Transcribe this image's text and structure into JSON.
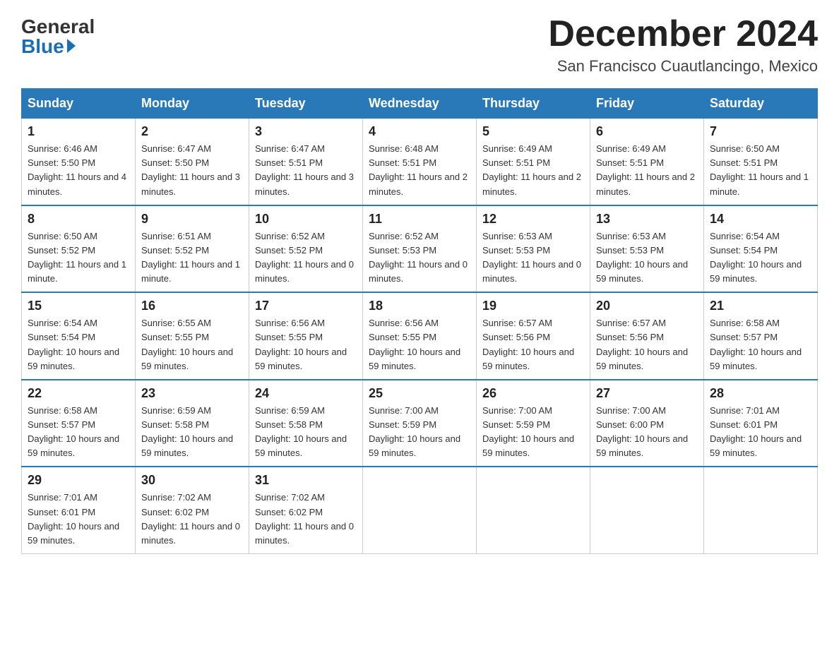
{
  "header": {
    "logo_general": "General",
    "logo_blue": "Blue",
    "month_year": "December 2024",
    "location": "San Francisco Cuautlancingo, Mexico"
  },
  "days_of_week": [
    "Sunday",
    "Monday",
    "Tuesday",
    "Wednesday",
    "Thursday",
    "Friday",
    "Saturday"
  ],
  "weeks": [
    [
      {
        "day": "1",
        "sunrise": "6:46 AM",
        "sunset": "5:50 PM",
        "daylight": "11 hours and 4 minutes."
      },
      {
        "day": "2",
        "sunrise": "6:47 AM",
        "sunset": "5:50 PM",
        "daylight": "11 hours and 3 minutes."
      },
      {
        "day": "3",
        "sunrise": "6:47 AM",
        "sunset": "5:51 PM",
        "daylight": "11 hours and 3 minutes."
      },
      {
        "day": "4",
        "sunrise": "6:48 AM",
        "sunset": "5:51 PM",
        "daylight": "11 hours and 2 minutes."
      },
      {
        "day": "5",
        "sunrise": "6:49 AM",
        "sunset": "5:51 PM",
        "daylight": "11 hours and 2 minutes."
      },
      {
        "day": "6",
        "sunrise": "6:49 AM",
        "sunset": "5:51 PM",
        "daylight": "11 hours and 2 minutes."
      },
      {
        "day": "7",
        "sunrise": "6:50 AM",
        "sunset": "5:51 PM",
        "daylight": "11 hours and 1 minute."
      }
    ],
    [
      {
        "day": "8",
        "sunrise": "6:50 AM",
        "sunset": "5:52 PM",
        "daylight": "11 hours and 1 minute."
      },
      {
        "day": "9",
        "sunrise": "6:51 AM",
        "sunset": "5:52 PM",
        "daylight": "11 hours and 1 minute."
      },
      {
        "day": "10",
        "sunrise": "6:52 AM",
        "sunset": "5:52 PM",
        "daylight": "11 hours and 0 minutes."
      },
      {
        "day": "11",
        "sunrise": "6:52 AM",
        "sunset": "5:53 PM",
        "daylight": "11 hours and 0 minutes."
      },
      {
        "day": "12",
        "sunrise": "6:53 AM",
        "sunset": "5:53 PM",
        "daylight": "11 hours and 0 minutes."
      },
      {
        "day": "13",
        "sunrise": "6:53 AM",
        "sunset": "5:53 PM",
        "daylight": "10 hours and 59 minutes."
      },
      {
        "day": "14",
        "sunrise": "6:54 AM",
        "sunset": "5:54 PM",
        "daylight": "10 hours and 59 minutes."
      }
    ],
    [
      {
        "day": "15",
        "sunrise": "6:54 AM",
        "sunset": "5:54 PM",
        "daylight": "10 hours and 59 minutes."
      },
      {
        "day": "16",
        "sunrise": "6:55 AM",
        "sunset": "5:55 PM",
        "daylight": "10 hours and 59 minutes."
      },
      {
        "day": "17",
        "sunrise": "6:56 AM",
        "sunset": "5:55 PM",
        "daylight": "10 hours and 59 minutes."
      },
      {
        "day": "18",
        "sunrise": "6:56 AM",
        "sunset": "5:55 PM",
        "daylight": "10 hours and 59 minutes."
      },
      {
        "day": "19",
        "sunrise": "6:57 AM",
        "sunset": "5:56 PM",
        "daylight": "10 hours and 59 minutes."
      },
      {
        "day": "20",
        "sunrise": "6:57 AM",
        "sunset": "5:56 PM",
        "daylight": "10 hours and 59 minutes."
      },
      {
        "day": "21",
        "sunrise": "6:58 AM",
        "sunset": "5:57 PM",
        "daylight": "10 hours and 59 minutes."
      }
    ],
    [
      {
        "day": "22",
        "sunrise": "6:58 AM",
        "sunset": "5:57 PM",
        "daylight": "10 hours and 59 minutes."
      },
      {
        "day": "23",
        "sunrise": "6:59 AM",
        "sunset": "5:58 PM",
        "daylight": "10 hours and 59 minutes."
      },
      {
        "day": "24",
        "sunrise": "6:59 AM",
        "sunset": "5:58 PM",
        "daylight": "10 hours and 59 minutes."
      },
      {
        "day": "25",
        "sunrise": "7:00 AM",
        "sunset": "5:59 PM",
        "daylight": "10 hours and 59 minutes."
      },
      {
        "day": "26",
        "sunrise": "7:00 AM",
        "sunset": "5:59 PM",
        "daylight": "10 hours and 59 minutes."
      },
      {
        "day": "27",
        "sunrise": "7:00 AM",
        "sunset": "6:00 PM",
        "daylight": "10 hours and 59 minutes."
      },
      {
        "day": "28",
        "sunrise": "7:01 AM",
        "sunset": "6:01 PM",
        "daylight": "10 hours and 59 minutes."
      }
    ],
    [
      {
        "day": "29",
        "sunrise": "7:01 AM",
        "sunset": "6:01 PM",
        "daylight": "10 hours and 59 minutes."
      },
      {
        "day": "30",
        "sunrise": "7:02 AM",
        "sunset": "6:02 PM",
        "daylight": "11 hours and 0 minutes."
      },
      {
        "day": "31",
        "sunrise": "7:02 AM",
        "sunset": "6:02 PM",
        "daylight": "11 hours and 0 minutes."
      },
      null,
      null,
      null,
      null
    ]
  ]
}
